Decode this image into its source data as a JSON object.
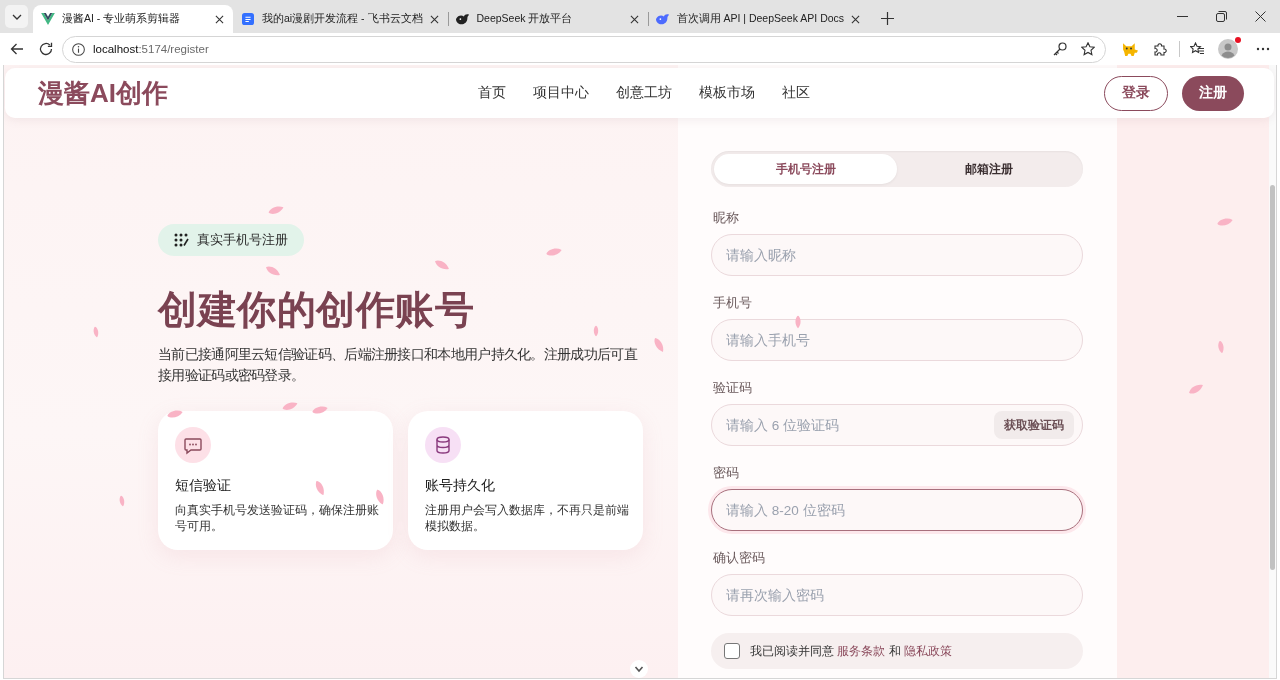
{
  "browser": {
    "tabs": [
      {
        "title": "漫酱AI - 专业萌系剪辑器",
        "kind": "vue",
        "selected": true
      },
      {
        "title": "我的ai漫剧开发流程 - 飞书云文档",
        "kind": "doc",
        "selected": false
      },
      {
        "title": "DeepSeek 开放平台",
        "kind": "whale",
        "selected": false
      },
      {
        "title": "首次调用 API | DeepSeek API Docs",
        "kind": "bluewhale",
        "selected": false
      }
    ],
    "url": {
      "host": "localhost",
      "path": ":5174/register"
    }
  },
  "header": {
    "logo": "漫酱AI创作",
    "nav": [
      "首页",
      "项目中心",
      "创意工坊",
      "模板市场",
      "社区"
    ],
    "buttons": [
      {
        "label": "登录",
        "kind": "outline"
      },
      {
        "label": "注册",
        "kind": "filled"
      }
    ]
  },
  "intro": {
    "badge": "真实手机号注册",
    "title": "创建你的创作账号",
    "description": "当前已接通阿里云短信验证码、后端注册接口和本地用户持久化。注册成功后可直接用验证码或密码登录。",
    "features": [
      {
        "kind": "sms",
        "title": "短信验证",
        "text": "向真实手机号发送验证码，确保注册账号可用。"
      },
      {
        "kind": "database",
        "title": "账号持久化",
        "text": "注册用户会写入数据库，不再只是前端模拟数据。"
      }
    ]
  },
  "form": {
    "tabs": [
      {
        "label": "手机号注册",
        "selected": true
      },
      {
        "label": "邮箱注册",
        "selected": false
      }
    ],
    "fields": [
      {
        "label": "昵称",
        "placeholder": "请输入昵称",
        "focused": false
      },
      {
        "label": "手机号",
        "placeholder": "请输入手机号",
        "focused": false
      },
      {
        "label": "验证码",
        "placeholder": "请输入 6 位验证码",
        "focused": false,
        "action": "获取验证码"
      },
      {
        "label": "密码",
        "placeholder": "请输入 8-20 位密码",
        "focused": true
      },
      {
        "label": "确认密码",
        "placeholder": "请再次输入密码",
        "focused": false
      }
    ],
    "agreement": {
      "checked": false,
      "parts": [
        {
          "kind": "text",
          "text": "我已阅读并同意"
        },
        {
          "kind": "link",
          "text": "服务条款"
        },
        {
          "kind": "text",
          "text": "和"
        },
        {
          "kind": "link",
          "text": "隐私政策"
        }
      ]
    }
  }
}
